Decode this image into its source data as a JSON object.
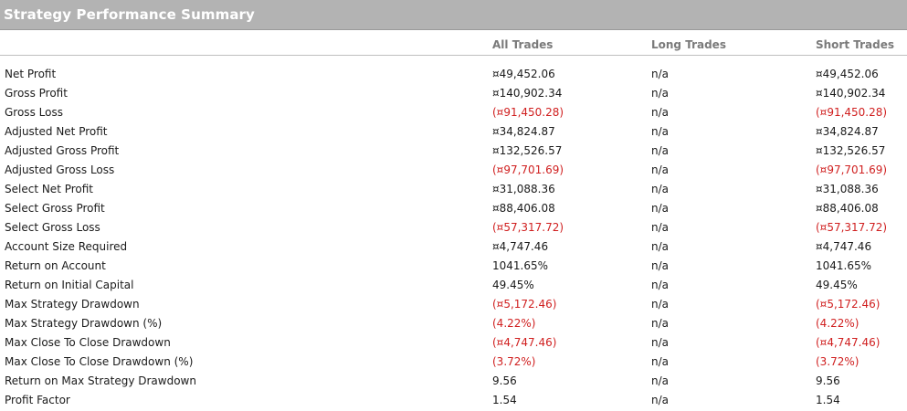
{
  "header": {
    "title": "Strategy Performance Summary"
  },
  "columns": [
    "All Trades",
    "Long Trades",
    "Short Trades"
  ],
  "colors": {
    "header_bg": "#b3b3b3",
    "negative": "#d02020",
    "column_header": "#7a7a7a"
  },
  "rows": [
    {
      "label": "Net Profit",
      "all": "¤49,452.06",
      "long": "n/a",
      "short": "¤49,452.06",
      "negative": false
    },
    {
      "label": "Gross Profit",
      "all": "¤140,902.34",
      "long": "n/a",
      "short": "¤140,902.34",
      "negative": false
    },
    {
      "label": "Gross Loss",
      "all": "(¤91,450.28)",
      "long": "n/a",
      "short": "(¤91,450.28)",
      "negative": true
    },
    {
      "label": "Adjusted Net Profit",
      "all": "¤34,824.87",
      "long": "n/a",
      "short": "¤34,824.87",
      "negative": false
    },
    {
      "label": "Adjusted Gross Profit",
      "all": "¤132,526.57",
      "long": "n/a",
      "short": "¤132,526.57",
      "negative": false
    },
    {
      "label": "Adjusted Gross Loss",
      "all": "(¤97,701.69)",
      "long": "n/a",
      "short": "(¤97,701.69)",
      "negative": true
    },
    {
      "label": "Select Net Profit",
      "all": "¤31,088.36",
      "long": "n/a",
      "short": "¤31,088.36",
      "negative": false
    },
    {
      "label": "Select Gross Profit",
      "all": "¤88,406.08",
      "long": "n/a",
      "short": "¤88,406.08",
      "negative": false
    },
    {
      "label": "Select Gross Loss",
      "all": "(¤57,317.72)",
      "long": "n/a",
      "short": "(¤57,317.72)",
      "negative": true
    },
    {
      "label": "Account Size Required",
      "all": "¤4,747.46",
      "long": "n/a",
      "short": "¤4,747.46",
      "negative": false
    },
    {
      "label": "Return on Account",
      "all": "1041.65%",
      "long": "n/a",
      "short": "1041.65%",
      "negative": false
    },
    {
      "label": "Return on Initial Capital",
      "all": "49.45%",
      "long": "n/a",
      "short": "49.45%",
      "negative": false
    },
    {
      "label": "Max Strategy Drawdown",
      "all": "(¤5,172.46)",
      "long": "n/a",
      "short": "(¤5,172.46)",
      "negative": true
    },
    {
      "label": "Max Strategy Drawdown (%)",
      "all": "(4.22%)",
      "long": "n/a",
      "short": "(4.22%)",
      "negative": true
    },
    {
      "label": "Max Close To Close Drawdown",
      "all": "(¤4,747.46)",
      "long": "n/a",
      "short": "(¤4,747.46)",
      "negative": true
    },
    {
      "label": "Max Close To Close Drawdown (%)",
      "all": "(3.72%)",
      "long": "n/a",
      "short": "(3.72%)",
      "negative": true
    },
    {
      "label": "Return on Max Strategy Drawdown",
      "all": "9.56",
      "long": "n/a",
      "short": "9.56",
      "negative": false
    },
    {
      "label": "Profit Factor",
      "all": "1.54",
      "long": "n/a",
      "short": "1.54",
      "negative": false
    }
  ]
}
